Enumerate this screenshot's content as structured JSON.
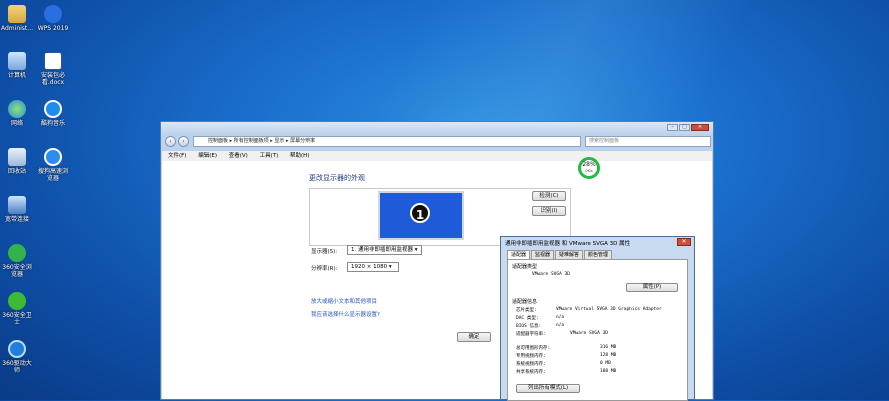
{
  "desktop": {
    "icons": [
      {
        "label": "Administ..."
      },
      {
        "label": "WPS 2019"
      },
      {
        "label": "计算机"
      },
      {
        "label": "安装包必看.docx"
      },
      {
        "label": "网络"
      },
      {
        "label": "酷狗音乐"
      },
      {
        "label": "回收站"
      },
      {
        "label": "搜狗高速浏览器"
      },
      {
        "label": "宽带连接"
      },
      {
        "label": "360安全浏览器"
      },
      {
        "label": "360安全卫士"
      },
      {
        "label": "360驱动大师"
      }
    ]
  },
  "window": {
    "address": "控制面板 ▸ 所有控制面板项 ▸ 显示 ▸ 屏幕分辨率",
    "search_placeholder": "搜索控制面板",
    "menu": [
      "文件(F)",
      "编辑(E)",
      "查看(V)",
      "工具(T)",
      "帮助(H)"
    ],
    "heading": "更改显示器的外观",
    "monitor_number": "1",
    "detect_button": "检测(C)",
    "identify_button": "识别(I)",
    "display_label": "显示器(S):",
    "display_value": "1. 通用非即插即用监视器",
    "resolution_label": "分辨率(R):",
    "resolution_value": "1920 × 1080",
    "link1": "放大或缩小文本和其他项目",
    "link2": "我应该选择什么显示器设置?",
    "ok_button": "确定"
  },
  "gauge": {
    "percent": "28%",
    "speed": "0K/s"
  },
  "dialog": {
    "title": "通用非即插即用监视器 和 VMware SVGA 3D 属性",
    "close": "✕",
    "tabs": [
      "适配器",
      "监视器",
      "疑难解答",
      "颜色管理"
    ],
    "adapter_type_label": "适配器类型",
    "adapter_type_value": "VMware SVGA 3D",
    "properties_button": "属性(P)",
    "adapter_info_label": "适配器信息",
    "info": [
      {
        "k": "芯片类型:",
        "v": "VMware Virtual SVGA 3D Graphics Adapter"
      },
      {
        "k": "DAC 类型:",
        "v": "n/a"
      },
      {
        "k": "BIOS 信息:",
        "v": "n/a"
      },
      {
        "k": "适配器字符串:",
        "v": "VMware SVGA 3D"
      }
    ],
    "memory": [
      {
        "k": "总可用图形内存:",
        "v": "316 MB"
      },
      {
        "k": "专用视频内存:",
        "v": "128 MB"
      },
      {
        "k": "系统视频内存:",
        "v": "0 MB"
      },
      {
        "k": "共享系统内存:",
        "v": "188 MB"
      }
    ],
    "list_modes_button": "列出所有模式(L)"
  },
  "colors": {
    "accent": "#1e5bd8",
    "close": "#c94f3c",
    "gauge": "#28b845"
  }
}
